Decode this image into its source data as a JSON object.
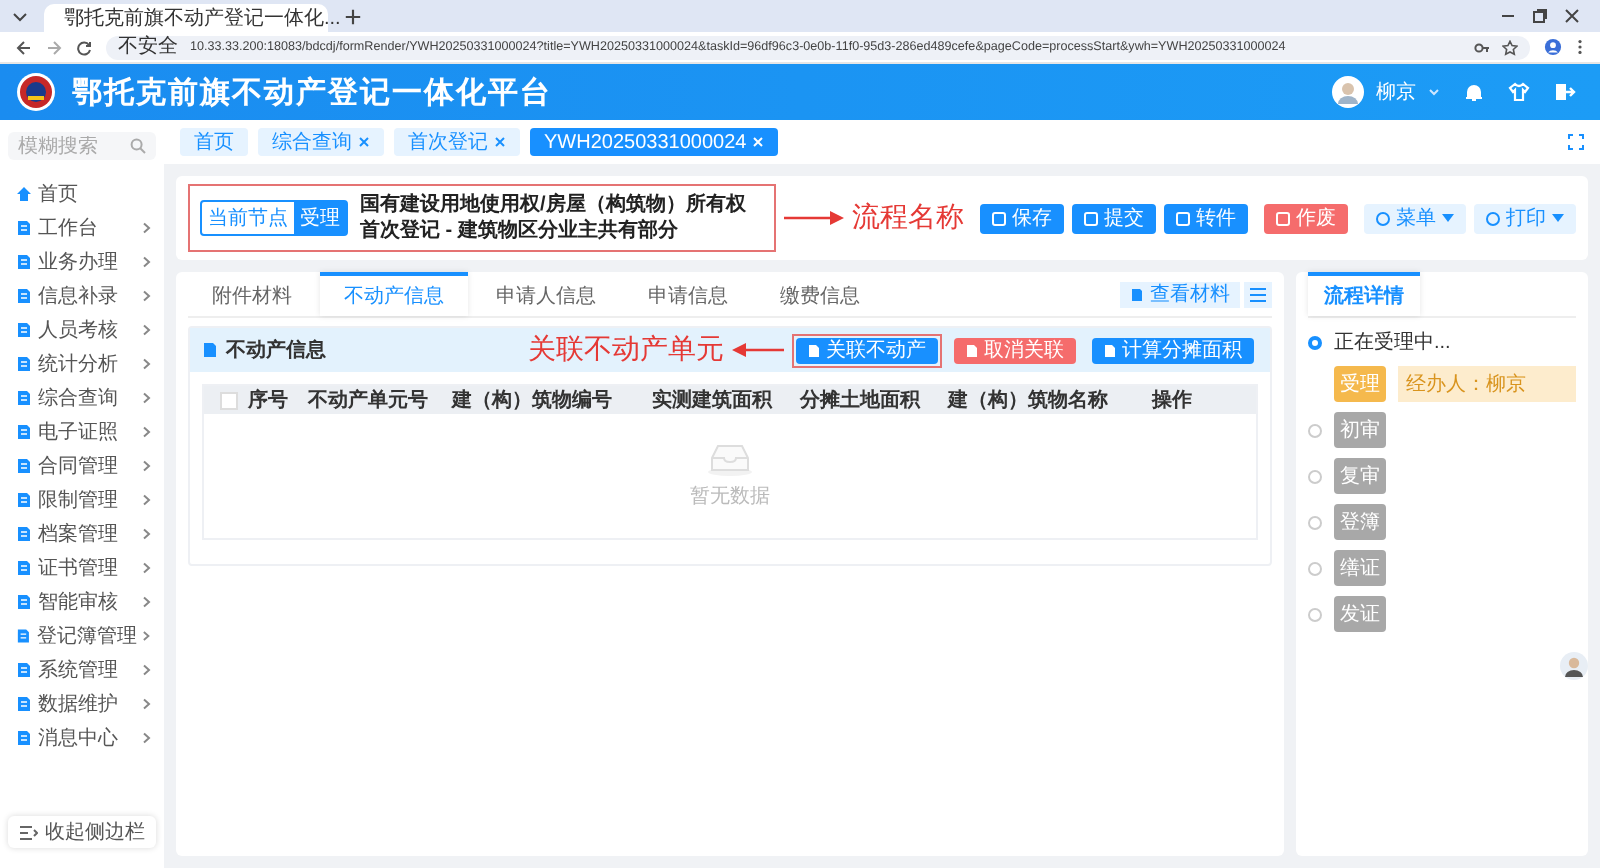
{
  "browser": {
    "tab_title": "鄂托克前旗不动产登记一体化...",
    "security": "不安全",
    "url": "10.33.33.200:18083/bdcdj/formRender/YWH20250331000024?title=YWH20250331000024&taskId=96df96c3-0e0b-11f0-95d3-286ed489cefe&pageCode=processStart&ywh=YWH20250331000024"
  },
  "header": {
    "title": "鄂托克前旗不动产登记一体化平台",
    "user": "柳京"
  },
  "sidebar": {
    "search": {
      "placeholder": "模糊搜索"
    },
    "items": [
      {
        "label": "首页",
        "expandable": false
      },
      {
        "label": "工作台",
        "expandable": true
      },
      {
        "label": "业务办理",
        "expandable": true
      },
      {
        "label": "信息补录",
        "expandable": true
      },
      {
        "label": "人员考核",
        "expandable": true
      },
      {
        "label": "统计分析",
        "expandable": true
      },
      {
        "label": "综合查询",
        "expandable": true
      },
      {
        "label": "电子证照",
        "expandable": true
      },
      {
        "label": "合同管理",
        "expandable": true
      },
      {
        "label": "限制管理",
        "expandable": true
      },
      {
        "label": "档案管理",
        "expandable": true
      },
      {
        "label": "证书管理",
        "expandable": true
      },
      {
        "label": "智能审核",
        "expandable": true
      },
      {
        "label": "登记簿管理",
        "expandable": true
      },
      {
        "label": "系统管理",
        "expandable": true
      },
      {
        "label": "数据维护",
        "expandable": true
      },
      {
        "label": "消息中心",
        "expandable": true
      }
    ],
    "collapse": "收起侧边栏"
  },
  "page_tabs": [
    {
      "label": "首页",
      "closable": false,
      "selected": false
    },
    {
      "label": "综合查询",
      "closable": true,
      "selected": false
    },
    {
      "label": "首次登记",
      "closable": true,
      "selected": false
    },
    {
      "label": "YWH20250331000024",
      "closable": true,
      "selected": true
    }
  ],
  "task": {
    "node_label": "当前节点",
    "node": "受理",
    "title": "国有建设用地使用权/房屋（构筑物）所有权首次登记 - 建筑物区分业主共有部分",
    "annotation": "流程名称"
  },
  "actions": [
    {
      "label": "保存",
      "kind": "primary"
    },
    {
      "label": "提交",
      "kind": "primary"
    },
    {
      "label": "转件",
      "kind": "primary"
    },
    {
      "label": "作废",
      "kind": "danger"
    },
    {
      "label": "菜单",
      "kind": "dropdown"
    },
    {
      "label": "打印",
      "kind": "dropdown"
    }
  ],
  "detail_tabs": [
    {
      "label": "附件材料",
      "selected": false
    },
    {
      "label": "不动产信息",
      "selected": true
    },
    {
      "label": "申请人信息",
      "selected": false
    },
    {
      "label": "申请信息",
      "selected": false
    },
    {
      "label": "缴费信息",
      "selected": false
    }
  ],
  "view_materials": "查看材料",
  "section": {
    "title": "不动产信息",
    "annotation": "关联不动产单元",
    "buttons": [
      {
        "label": "关联不动产",
        "kind": "primary",
        "highlighted": true
      },
      {
        "label": "取消关联",
        "kind": "danger",
        "highlighted": false
      },
      {
        "label": "计算分摊面积",
        "kind": "primary",
        "highlighted": false
      }
    ]
  },
  "table": {
    "columns": [
      "序号",
      "不动产单元号",
      "建（构）筑物编号",
      "实测建筑面积",
      "分摊土地面积",
      "建（构）筑物名称",
      "操作"
    ],
    "empty_text": "暂无数据",
    "select_all_checked": false
  },
  "process": {
    "tab": "流程详情",
    "status": "正在受理中...",
    "steps": [
      {
        "label": "受理",
        "current": true,
        "handler": "经办人：柳京"
      },
      {
        "label": "初审",
        "current": false
      },
      {
        "label": "复审",
        "current": false
      },
      {
        "label": "登簿",
        "current": false
      },
      {
        "label": "缮证",
        "current": false
      },
      {
        "label": "发证",
        "current": false
      }
    ]
  }
}
